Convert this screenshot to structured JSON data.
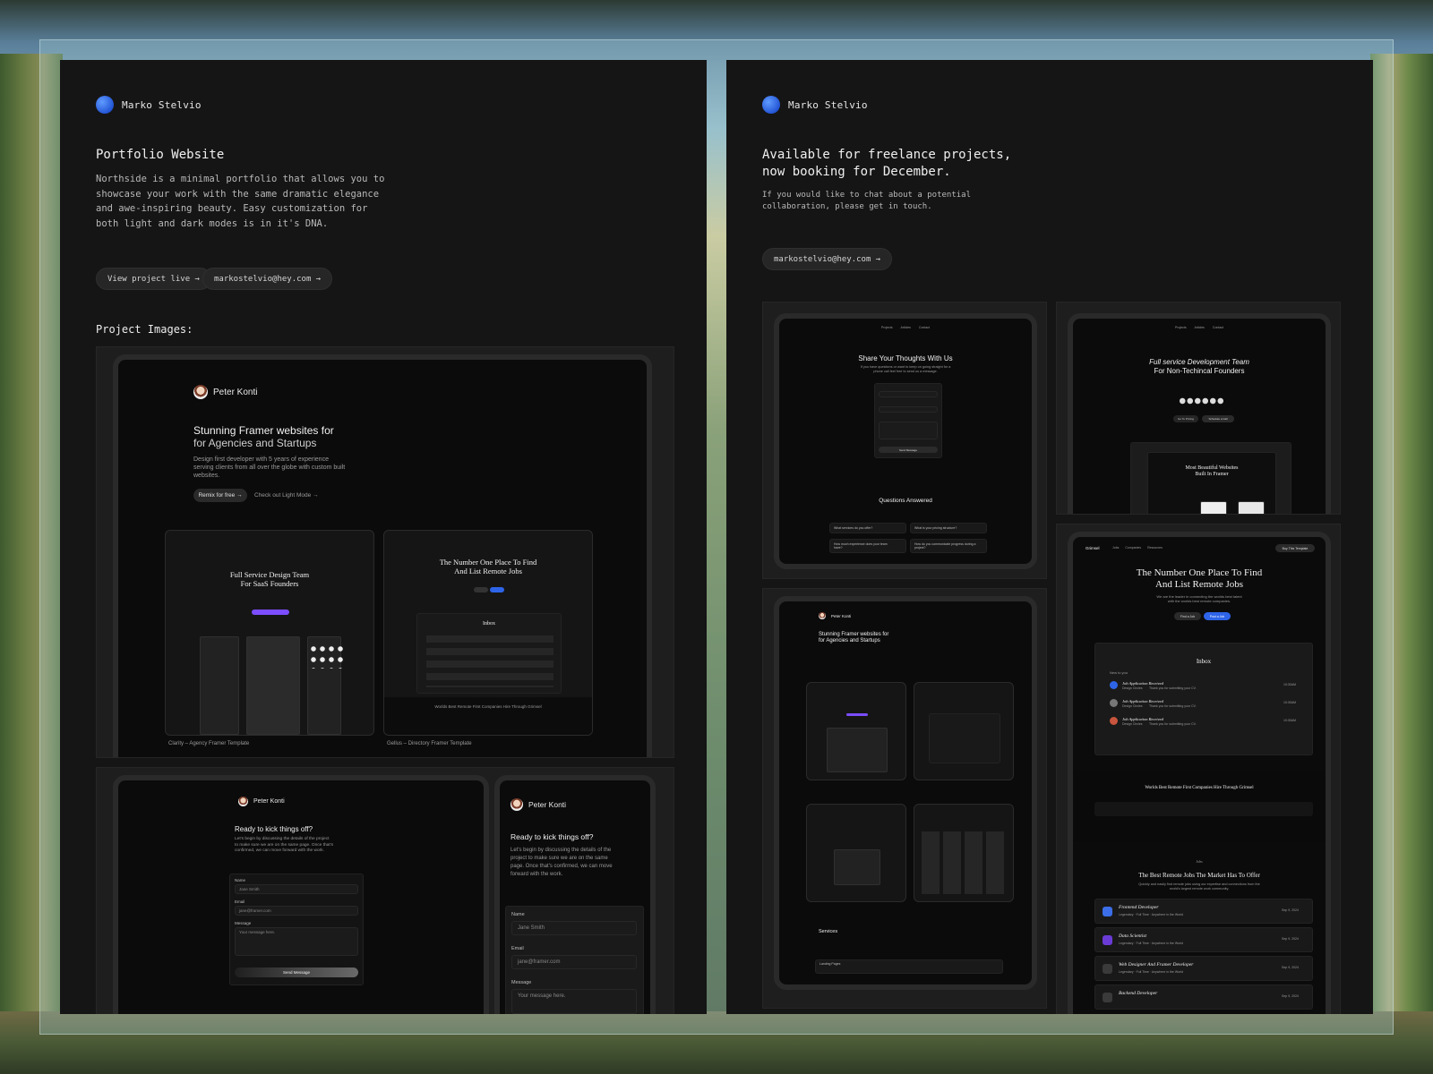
{
  "left": {
    "brand": "Marko Stelvio",
    "title": "Portfolio Website",
    "description": "Northside is a minimal portfolio that allows you to showcase your work with the same dramatic elegance and awe-inspiring beauty. Easy customization for both light and dark modes is in it's DNA.",
    "buttons": {
      "view_live": "View project live →",
      "email": "markostelvio@hey.com →"
    },
    "section_label": "Project Images:",
    "mock1": {
      "brand": "Peter Konti",
      "headline1": "Stunning Framer websites for",
      "headline2": "for Agencies and Startups",
      "sub": "Design first developer with 5 years of experience serving clients from all over the globe with custom built websites.",
      "cta": "Remix for free →",
      "link": "Check out Light Mode →",
      "thumb1_title": "Full Service Design Team For SaaS Founders",
      "thumb2_title": "The Number One Place To Find And List Remote Jobs",
      "thumb2_inbox": "Inbox",
      "thumb2_footer": "Worlds Best Remote First Companies Hire Through Grimsel",
      "caption1": "Clarity – Agency Framer Template",
      "caption2": "Gellus – Directory Framer Template"
    },
    "mock2": {
      "brand": "Peter Konti",
      "heading": "Ready to kick things off?",
      "sub": "Let's begin by discussing the details of the project to make sure we are on the same page. Once that's confirmed, we can move forward with the work.",
      "name_label": "Name",
      "name_value": "Jane Smith",
      "email_label": "Email",
      "email_value": "jane@framer.com",
      "message_label": "Message",
      "message_value": "Your message here.",
      "send": "Send Message"
    },
    "mock3": {
      "brand": "Peter Konti",
      "heading": "Ready to kick things off?",
      "sub": "Let's begin by discussing the details of the project to make sure we are on the same page. Once that's confirmed, we can move forward with the work.",
      "name_label": "Name",
      "name_value": "Jane Smith",
      "email_label": "Email",
      "email_value": "jane@framer.com",
      "message_label": "Message",
      "message_value": "Your message here."
    }
  },
  "right": {
    "brand": "Marko Stelvio",
    "title": "Available for freelance projects,\nnow booking for December.",
    "description": "If you would like to chat about a potential collaboration, please get in touch.",
    "buttons": {
      "email": "markostelvio@hey.com →"
    },
    "mockA": {
      "nav": [
        "Projects",
        "Articles",
        "Contact"
      ],
      "heading": "Share Your Thoughts With Us",
      "sub": "If you have questions or want to keep on going straight for a phone call feel free to send us a message.",
      "send": "Send Message",
      "faq_title": "Questions Answered",
      "faq": [
        "What services do you offer?",
        "What is your pricing structure?",
        "How much experience does your team have?",
        "How do you communicate progress during a project?"
      ]
    },
    "mockB": {
      "nav": [
        "Projects",
        "Articles",
        "Contact"
      ],
      "heading1": "Full service Development Team",
      "heading2": "For Non-Techincal Founders",
      "btn1": "Go To Pricing",
      "btn2": "Schedule a Call",
      "inner_title": "Most Beautiful Websites Built In Framer"
    },
    "mockC": {
      "brand": "Peter Konti",
      "headline1": "Stunning Framer websites for",
      "headline2": "for Agencies and Startups",
      "services_title": "Services",
      "landing_label": "Landing Pages"
    },
    "mockD": {
      "logo": "Grimsel",
      "nav": [
        "Jobs",
        "Companies",
        "Resources"
      ],
      "cta": "Buy This Template",
      "heading": "The Number One Place To Find And List Remote Jobs",
      "sub": "We are the leader in connecting the worlds best talent with the worlds best remote companies.",
      "btn1": "Find a Job",
      "btn2": "Post a Job",
      "inbox": "Inbox",
      "inbox_new": "New to you",
      "messages": [
        {
          "title": "Job Application Received",
          "from": "Design Circles",
          "text": "Thank you for submitting your CV.",
          "time": "10:30AM"
        },
        {
          "title": "Job Application Received",
          "from": "Design Circles",
          "text": "Thank you for submitting your CV.",
          "time": "10:30AM"
        },
        {
          "title": "Job Application Received",
          "from": "Design Circles",
          "text": "Thank you for submitting your CV.",
          "time": "10:30AM"
        }
      ],
      "companies_title": "Worlds Best Remote First Companies Hire Through Grimsel",
      "jobs_tag": "Jobs",
      "jobs_heading": "The Best Remote Jobs The Market Has To Offer",
      "jobs_sub": "Quickly and easily find remote jobs using our expertise and connections from the world's largest remote work community.",
      "jobs": [
        {
          "title": "Frontend Developer",
          "meta": "Legendary · Full Time · Anywhere in the World",
          "date": "Sep 9, 2024",
          "color": "#3b6ee8"
        },
        {
          "title": "Data Scientist",
          "meta": "Legendary · Full Time · Anywhere in the World",
          "date": "Sep 9, 2024",
          "color": "#6b3bd6"
        },
        {
          "title": "Web Designer And Framer Developer",
          "meta": "Legendary · Full Time · Anywhere in the World",
          "date": "Sep 9, 2024",
          "color": "#3a3a3a"
        },
        {
          "title": "Backend Developer",
          "meta": "",
          "date": "Sep 9, 2024",
          "color": "#3a3a3a"
        }
      ]
    }
  },
  "colors": {
    "panel_bg": "#151515",
    "accent_blue": "#2e64e8",
    "accent_purple": "#7b4dff"
  }
}
